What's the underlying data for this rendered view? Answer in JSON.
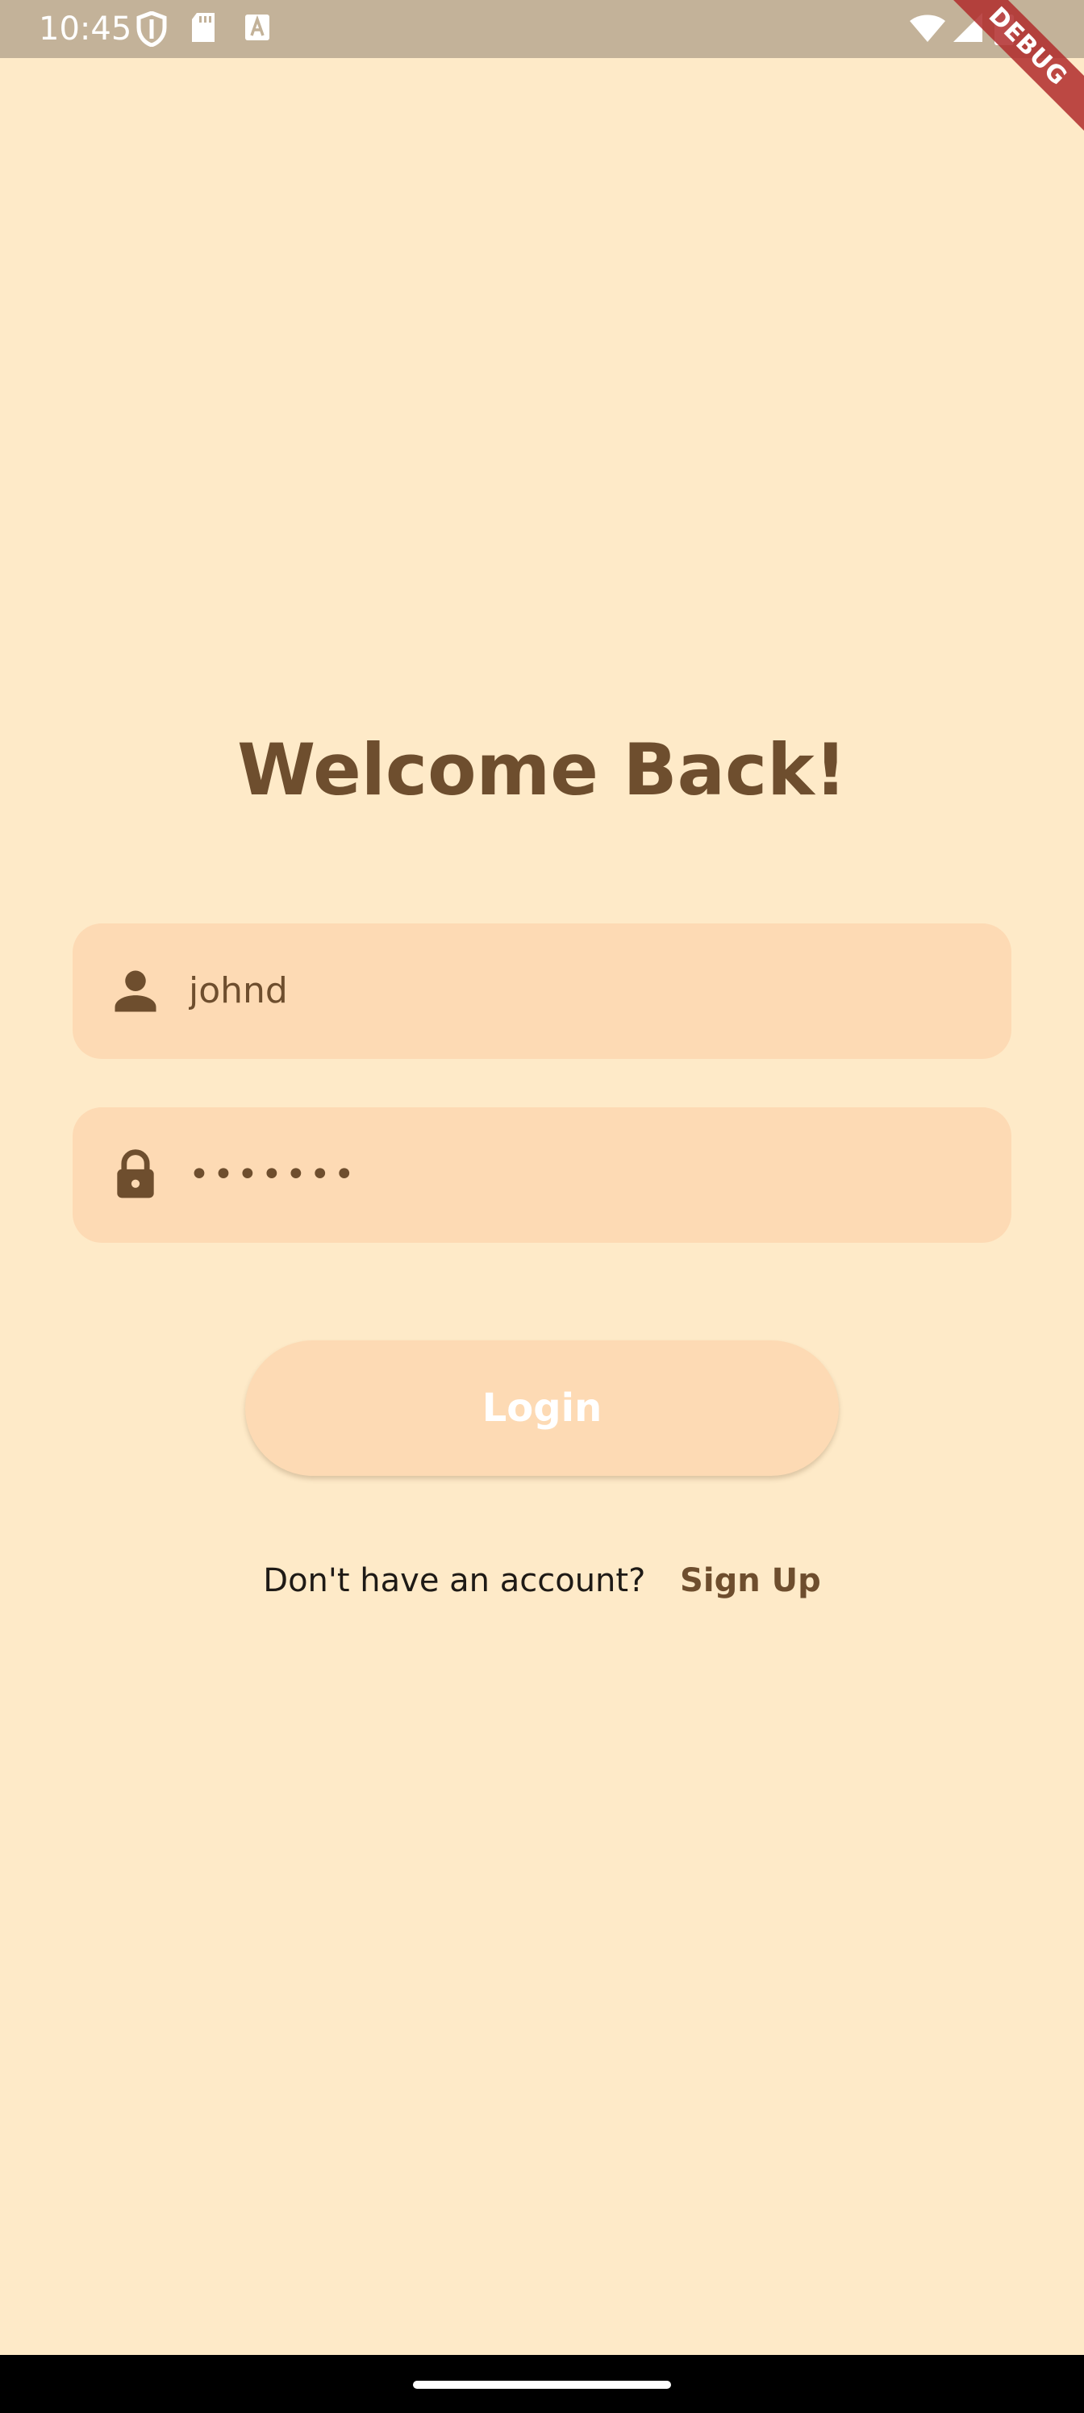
{
  "status_bar": {
    "time": "10:45",
    "left_icons": [
      "shield-icon",
      "sd-card-icon",
      "keyboard-a-icon"
    ],
    "right_icons": [
      "wifi-icon",
      "signal-icon",
      "battery-icon"
    ]
  },
  "debug_banner": "DEBUG",
  "login": {
    "title": "Welcome Back!",
    "username": {
      "icon": "person-icon",
      "value": "johnd"
    },
    "password": {
      "icon": "lock-icon",
      "value": "•••••••"
    },
    "login_button_label": "Login",
    "signup_prompt": "Don't have an account?",
    "signup_link_label": "Sign Up"
  },
  "colors": {
    "background": "#FEEAC8",
    "field_fill": "#FDDAB4",
    "accent_brown": "#6E4E2E",
    "status_bar": "#C3B299"
  }
}
